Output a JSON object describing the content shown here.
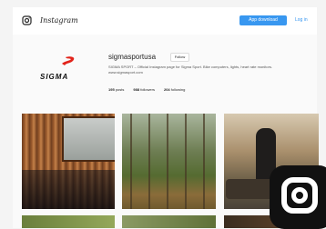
{
  "header": {
    "logo_icon": "instagram-glyph-icon",
    "wordmark": "Instagram",
    "app_button_label": "App download",
    "login_label": "Log in"
  },
  "profile": {
    "avatar_brand": "SIGMA",
    "username": "sigmasportusa",
    "follow_label": "Follow",
    "bio": "SIGMA SPORT – Official Instagram page for Sigma Sport. Bike computers, lights, heart rate monitors. www.sigmasport.com",
    "stats": {
      "posts_value": "195",
      "posts_label": "posts",
      "followers_value": "988",
      "followers_label": "followers",
      "following_value": "204",
      "following_label": "following"
    }
  },
  "posts": [
    {
      "subject": "bikes-against-wooden-cabin"
    },
    {
      "subject": "forest-trail"
    },
    {
      "subject": "rider-on-log"
    },
    {
      "subject": "grass-field"
    },
    {
      "subject": "trail-path"
    },
    {
      "subject": "dark-woods"
    }
  ],
  "overlay": {
    "icon": "instagram-logo-icon"
  },
  "colors": {
    "accent": "#3897f0",
    "sigma_red": "#e2231a",
    "text": "#262626"
  }
}
